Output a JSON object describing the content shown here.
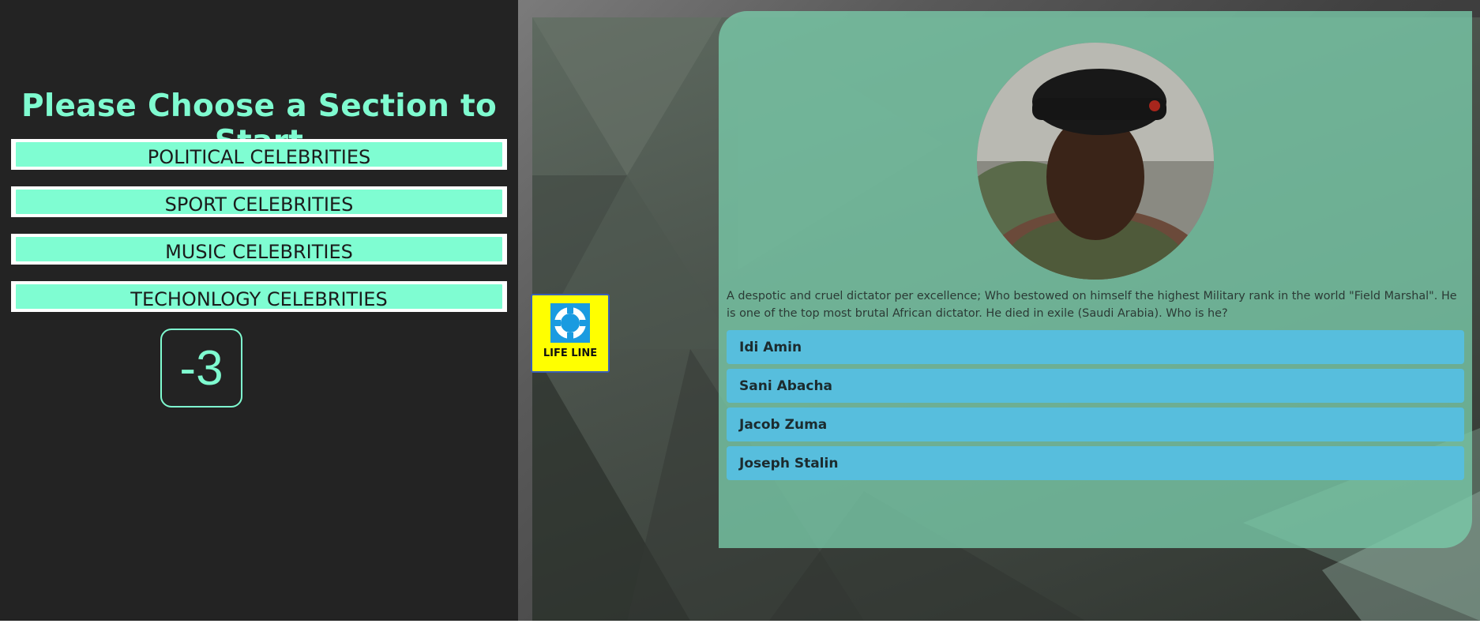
{
  "sidebar": {
    "title": "Please Choose a Section to Start",
    "sections": [
      {
        "label": "POLITICAL CELEBRITIES"
      },
      {
        "label": "SPORT CELEBRITIES"
      },
      {
        "label": "MUSIC CELEBRITIES"
      },
      {
        "label": "TECHONLOGY CELEBRITIES"
      }
    ],
    "score": "-3"
  },
  "lifeline": {
    "label": "LIFE LINE",
    "icon": "lifebuoy-icon"
  },
  "quiz": {
    "question": "A despotic and cruel dictator per excellence; Who bestowed on himself the highest Military rank in the world \"Field Marshal\". He is one of the top most brutal African dictator. He died in exile (Saudi Arabia). Who is he?",
    "answers": [
      {
        "label": "Idi Amin"
      },
      {
        "label": "Sani Abacha"
      },
      {
        "label": "Jacob Zuma"
      },
      {
        "label": "Joseph Stalin"
      }
    ]
  },
  "colors": {
    "accent": "#7ffbd0",
    "sidebar_bg": "#232323",
    "card_bg": "#7acca9",
    "answer_bg": "#57bedd",
    "lifeline_bg": "#ffff00"
  }
}
